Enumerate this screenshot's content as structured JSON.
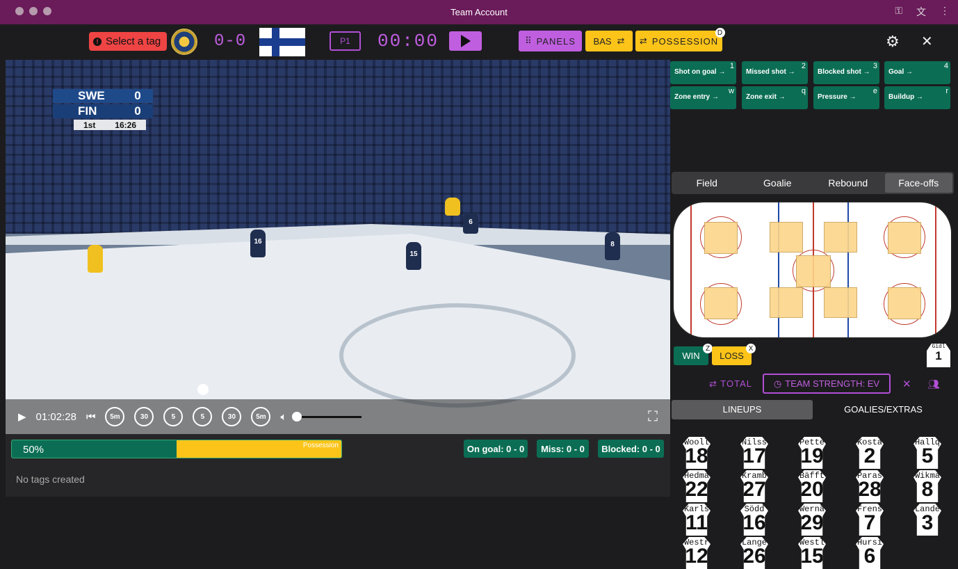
{
  "window": {
    "title": "Team Account"
  },
  "topbar": {
    "select_tag": "Select a tag",
    "score": "0-0",
    "period": "P1",
    "clock": "00:00",
    "panels": "PANELS",
    "bas": "BAS",
    "possession": "POSSESSION",
    "possession_key": "D"
  },
  "video": {
    "scorebug": {
      "home": "SWE",
      "home_score": "0",
      "away": "FIN",
      "away_score": "0",
      "period": "1st",
      "time": "16:26"
    },
    "player_numbers": [
      "16",
      "15",
      "6",
      "8"
    ],
    "controls": {
      "time": "01:02:28",
      "rewinds": [
        "5m",
        "30",
        "5"
      ],
      "forwards": [
        "5",
        "30",
        "5m"
      ]
    }
  },
  "possession_bar": {
    "percent": "50%",
    "label": "Possession",
    "value": 0.5
  },
  "stats": {
    "on_goal": "On goal: 0 - 0",
    "miss": "Miss: 0 - 0",
    "blocked": "Blocked: 0 - 0"
  },
  "tags_status": "No tags created",
  "event_buttons": [
    {
      "label": "Shot on goal →",
      "key": "1"
    },
    {
      "label": "Missed shot →",
      "key": "2"
    },
    {
      "label": "Blocked shot →",
      "key": "3"
    },
    {
      "label": "Goal →",
      "key": "4"
    },
    {
      "label": "Zone entry →",
      "key": "w"
    },
    {
      "label": "Zone exit →",
      "key": "q"
    },
    {
      "label": "Pressure →",
      "key": "e"
    },
    {
      "label": "Buildup →",
      "key": "r"
    }
  ],
  "field_tabs": [
    {
      "label": "Field"
    },
    {
      "label": "Goalie"
    },
    {
      "label": "Rebound"
    },
    {
      "label": "Face-offs",
      "active": true
    }
  ],
  "faceoff": {
    "win": "WIN",
    "win_key": "Z",
    "loss": "LOSS",
    "loss_key": "X",
    "goalie_name": "Gidl",
    "goalie_number": "1"
  },
  "strength": {
    "total": "TOTAL",
    "team_strength": "TEAM STRENGTH: EV"
  },
  "lineup_tabs": {
    "lineups": "LINEUPS",
    "goalies": "GOALIES/EXTRAS"
  },
  "roster": [
    {
      "name": "Wooll",
      "number": "18"
    },
    {
      "name": "Nilss",
      "number": "17"
    },
    {
      "name": "Pette",
      "number": "19"
    },
    {
      "name": "Kosta",
      "number": "2"
    },
    {
      "name": "Hallq",
      "number": "5"
    },
    {
      "name": "Hedma",
      "number": "22"
    },
    {
      "name": "Kramb",
      "number": "27"
    },
    {
      "name": "Bäfft",
      "number": "20"
    },
    {
      "name": "Paras",
      "number": "28"
    },
    {
      "name": "Wikma",
      "number": "8"
    },
    {
      "name": "Karls",
      "number": "11"
    },
    {
      "name": "Södd",
      "number": "16"
    },
    {
      "name": "Wernä",
      "number": "29"
    },
    {
      "name": "Frens",
      "number": "7"
    },
    {
      "name": "Lande",
      "number": "3"
    },
    {
      "name": "Westr",
      "number": "12"
    },
    {
      "name": "Lange",
      "number": "26"
    },
    {
      "name": "Westl",
      "number": "15"
    },
    {
      "name": "Hursi",
      "number": "6"
    }
  ],
  "colors": {
    "accent": "#c05ee0",
    "green": "#0b6e54",
    "yellow": "#fcc419",
    "red": "#ef4444",
    "titlebar": "#6a1b5a"
  }
}
